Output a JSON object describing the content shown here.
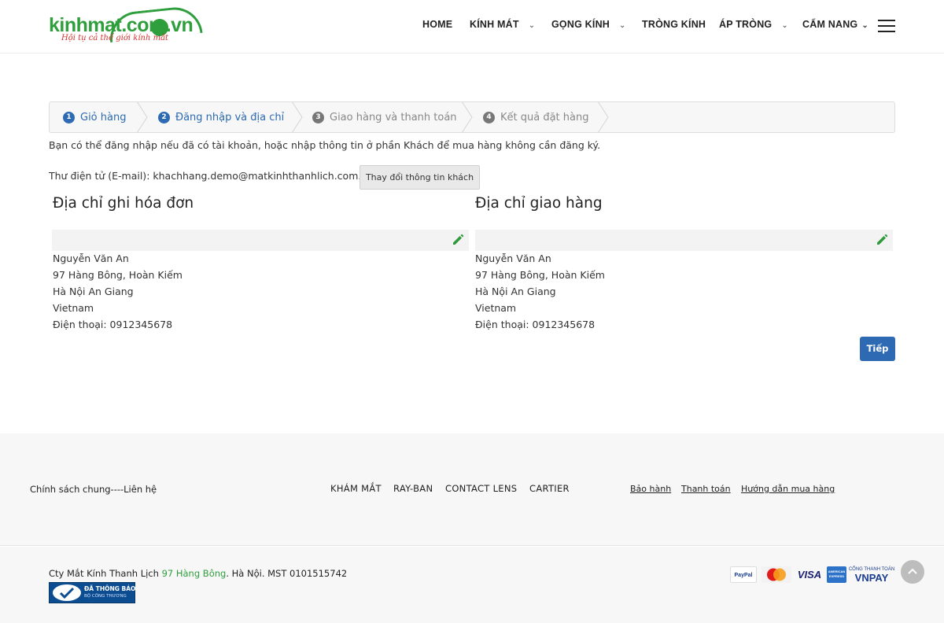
{
  "header": {
    "logo_text": "kinhmat.com.vn",
    "logo_tagline": "Hội tụ cả thế giới kính mắt",
    "nav": [
      {
        "label": "HOME",
        "dropdown": false
      },
      {
        "label": "KÍNH MÁT",
        "dropdown": true
      },
      {
        "label": "GỌNG KÍNH",
        "dropdown": true
      },
      {
        "label": "TRÒNG KÍNH",
        "dropdown": false
      },
      {
        "label": "ÁP TRÒNG",
        "dropdown": true
      },
      {
        "label": "CẨM NANG",
        "dropdown": true
      }
    ],
    "menu_icon": "hamburger-icon"
  },
  "checkout": {
    "steps": [
      {
        "num": "1",
        "label": "Giỏ hàng",
        "state": "active"
      },
      {
        "num": "2",
        "label": "Đăng nhập và địa chỉ",
        "state": "active"
      },
      {
        "num": "3",
        "label": "Giao hàng và thanh toán",
        "state": "inactive"
      },
      {
        "num": "4",
        "label": "Kết quả đặt hàng",
        "state": "inactive"
      }
    ],
    "intro": "Bạn có thể đăng nhập nếu đã có tài khoản, hoặc nhập thông tin ở phần Khách để mua hàng không cần đăng ký.",
    "email_label": "Thư điện tử (E-mail): khachhang.demo@matkinhthanhlich.com.vn",
    "change_button": "Thay đổi thông tin khách",
    "billing": {
      "title": "Địa chỉ ghi hóa đơn",
      "name": "Nguyễn Văn An",
      "street": "97 Hàng Bông, Hoàn Kiếm",
      "city": "Hà Nội An Giang",
      "country": "Vietnam",
      "phone": "Điện thoại: 0912345678"
    },
    "shipping": {
      "title": "Địa chỉ giao hàng",
      "name": "Nguyễn Văn An",
      "street": "97 Hàng Bông, Hoàn Kiếm",
      "city": "Hà Nội An Giang",
      "country": "Vietnam",
      "phone": "Điện thoại: 0912345678"
    },
    "edit_icon": "pencil-icon",
    "next_button": "Tiếp"
  },
  "footer": {
    "policy": "Chính sách chung----Liên hệ",
    "brands": [
      "KHÁM MẮT",
      "RAY-BAN",
      "CONTACT LENS",
      "CARTIER"
    ],
    "links": [
      "Bảo hành",
      "Thanh toán",
      "Hướng dẫn mua hàng"
    ],
    "company_prefix": "Cty Mắt Kính Thanh Lịch ",
    "company_address": "97 Hàng Bông",
    "company_suffix": ". Hà Nội. MST 0101515742",
    "badge_line1": "ĐÃ THÔNG BÁO",
    "badge_line2": "BỘ CÔNG THƯƠNG",
    "payments": [
      "PayPal",
      "MasterCard",
      "VISA",
      "AMERICAN EXPRESS",
      "CỔNG THANH TOÁN",
      "VNPAY"
    ]
  },
  "colors": {
    "brand_green": "#2f9e3c",
    "accent_blue": "#2d6ab3",
    "edit_green": "#2e9a3c"
  }
}
